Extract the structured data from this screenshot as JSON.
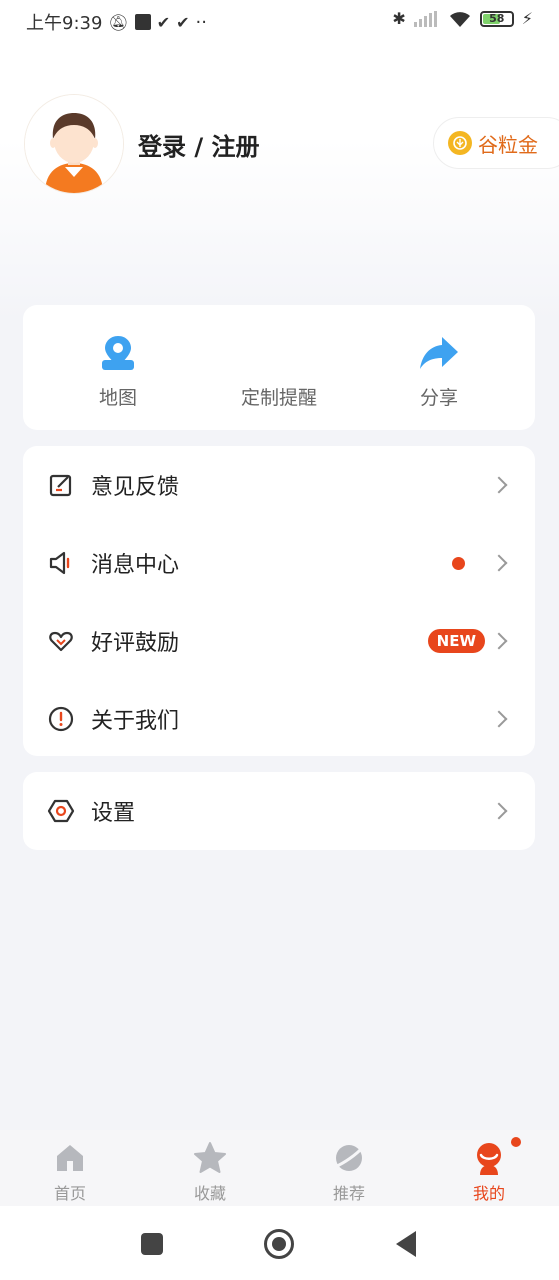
{
  "status_bar": {
    "time": "上午9:39",
    "battery": "58"
  },
  "profile": {
    "login_label": "登录 / 注册",
    "gold_label": "谷粒金"
  },
  "quick_actions": [
    {
      "label": "地图",
      "icon": "map-pin-icon"
    },
    {
      "label": "定制提醒",
      "icon": ""
    },
    {
      "label": "分享",
      "icon": "share-arrow-icon"
    }
  ],
  "menu": {
    "feedback": "意见反馈",
    "messages": "消息中心",
    "rating": "好评鼓励",
    "rating_badge": "NEW",
    "about": "关于我们",
    "settings": "设置"
  },
  "tabs": [
    {
      "label": "首页",
      "icon": "home-icon"
    },
    {
      "label": "收藏",
      "icon": "star-icon"
    },
    {
      "label": "推荐",
      "icon": "planet-icon"
    },
    {
      "label": "我的",
      "icon": "profile-icon"
    }
  ],
  "colors": {
    "accent": "#e8461c",
    "blue": "#3ea2f0",
    "gold": "#f4b622"
  }
}
